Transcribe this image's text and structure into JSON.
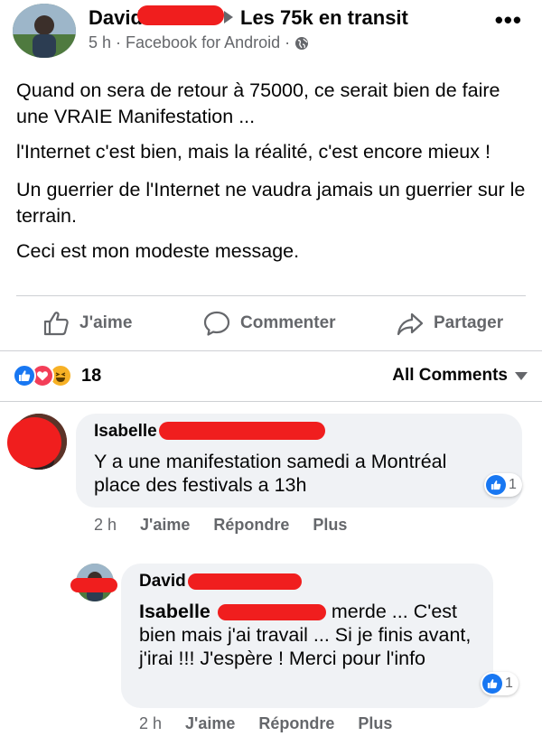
{
  "post": {
    "author": "David",
    "group": "Les 75k en transit",
    "meta": "5 h · Facebook for Android ·",
    "more_icon": "more-icon",
    "paragraphs": [
      "Quand on sera de retour à 75000, ce serait bien de faire une VRAIE Manifestation ...",
      "l'Internet c'est bien, mais la réalité, c'est encore mieux !",
      "Un guerrier de l'Internet ne vaudra jamais un guerrier sur le terrain.",
      "Ceci est mon modeste message."
    ]
  },
  "actions": {
    "like": "J'aime",
    "comment": "Commenter",
    "share": "Partager"
  },
  "reactions": {
    "count": "18",
    "types": [
      "like",
      "love",
      "haha"
    ],
    "filter_label": "All Comments"
  },
  "comments": [
    {
      "name": "Isabelle",
      "text": "Y a une manifestation samedi a Montréal place des festivals a 13h",
      "likes": "1",
      "time": "2 h",
      "like_label": "J'aime",
      "reply_label": "Répondre",
      "more_label": "Plus"
    },
    {
      "name": "David",
      "mention": "Isabelle",
      "text_after_mention": "merde ... C'est bien mais j'ai travail ... Si je finis avant, j'irai !!! J'espère ! Merci pour l'info",
      "likes": "1",
      "time": "2 h",
      "like_label": "J'aime",
      "reply_label": "Répondre",
      "more_label": "Plus"
    }
  ],
  "colors": {
    "accent": "#1877f2",
    "redaction": "#f01e1e",
    "secondary_text": "#65676b",
    "bubble": "#f0f2f5"
  }
}
